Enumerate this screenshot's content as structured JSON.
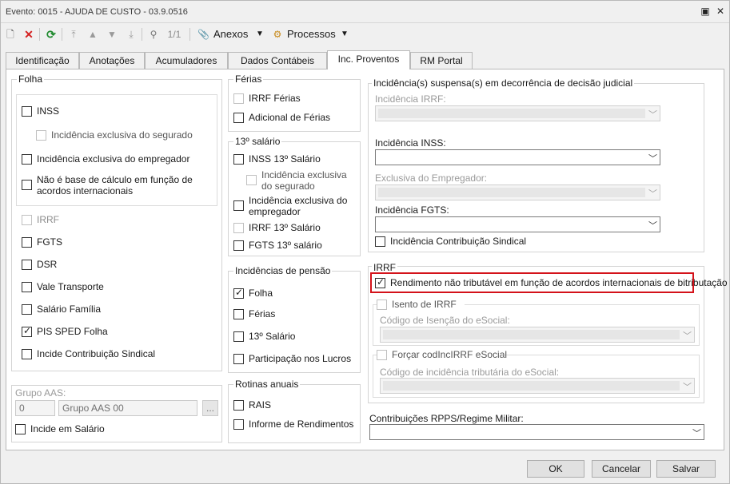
{
  "window": {
    "title": "Evento: 0015 - AJUDA DE CUSTO - 03.9.0516",
    "restore_icon": "restore-icon",
    "close_icon": "close-icon"
  },
  "toolbar": {
    "record_counter": "1/1",
    "anexos_label": "Anexos",
    "processos_label": "Processos"
  },
  "tabs": [
    "Identificação",
    "Anotações",
    "Acumuladores",
    "Dados Contábeis",
    "Inc. Proventos",
    "RM Portal"
  ],
  "active_tab": "Inc. Proventos",
  "folha": {
    "title": "Folha",
    "inss": "INSS",
    "inc_exclusiva_segurado": "Incidência exclusiva do segurado",
    "inc_exclusiva_empregador": "Incidência exclusiva do empregador",
    "nao_base": "Não é base de cálculo em função de acordos internacionais",
    "irrf": "IRRF",
    "fgts": "FGTS",
    "dsr": "DSR",
    "vale_transporte": "Vale Transporte",
    "salario_familia": "Salário Família",
    "pis_sped": "PIS SPED Folha",
    "incide_contrib_sindical": "Incide Contribuição Sindical"
  },
  "grupo_aas": {
    "label": "Grupo AAS:",
    "code": "0",
    "name": "Grupo AAS 00",
    "lookup": "...",
    "incide_salario": "Incide em Salário"
  },
  "ferias": {
    "title": "Férias",
    "irrf_ferias": "IRRF Férias",
    "adicional_ferias": "Adicional de Férias"
  },
  "decimo": {
    "title": "13º salário",
    "inss_13": "INSS 13º Salário",
    "inc_excl_segurado": "Incidência exclusiva do segurado",
    "inc_excl_empregador": "Incidência exclusiva do empregador",
    "irrf_13": "IRRF 13º Salário",
    "fgts_13": "FGTS 13º salário"
  },
  "pensao": {
    "title": "Incidências de pensão",
    "folha": "Folha",
    "ferias": "Férias",
    "decimo": "13º Salário",
    "plr": "Participação nos Lucros"
  },
  "rotinas": {
    "title": "Rotinas anuais",
    "rais": "RAIS",
    "informe": "Informe de Rendimentos"
  },
  "judicial": {
    "title": "Incidência(s) suspensa(s) em decorrência de decisão judicial",
    "inc_irrf": "Incidência IRRF:",
    "inc_inss": "Incidência INSS:",
    "excl_empregador": "Exclusiva do Empregador:",
    "inc_fgts": "Incidência FGTS:",
    "inc_contrib_sindical": "Incidência Contribuição Sindical"
  },
  "irrf": {
    "title": "IRRF",
    "rendimento_nao_trib": "Rendimento não tributável em função de acordos internacionais de bitributação",
    "isento": "Isento de IRRF",
    "cod_isencao": "Código de Isenção do eSocial:",
    "forcar": "Forçar codIncIRRF eSocial",
    "cod_incidencia": "Código de incidência tributária do eSocial:"
  },
  "rpps": {
    "label": "Contribuições RPPS/Regime Militar:"
  },
  "buttons": {
    "ok": "OK",
    "cancel": "Cancelar",
    "save": "Salvar"
  },
  "states": {
    "pis_sped_checked": true,
    "pensao_folha_checked": true,
    "rendimento_nao_trib_checked": true
  },
  "colors": {
    "highlight": "#d4121a"
  }
}
